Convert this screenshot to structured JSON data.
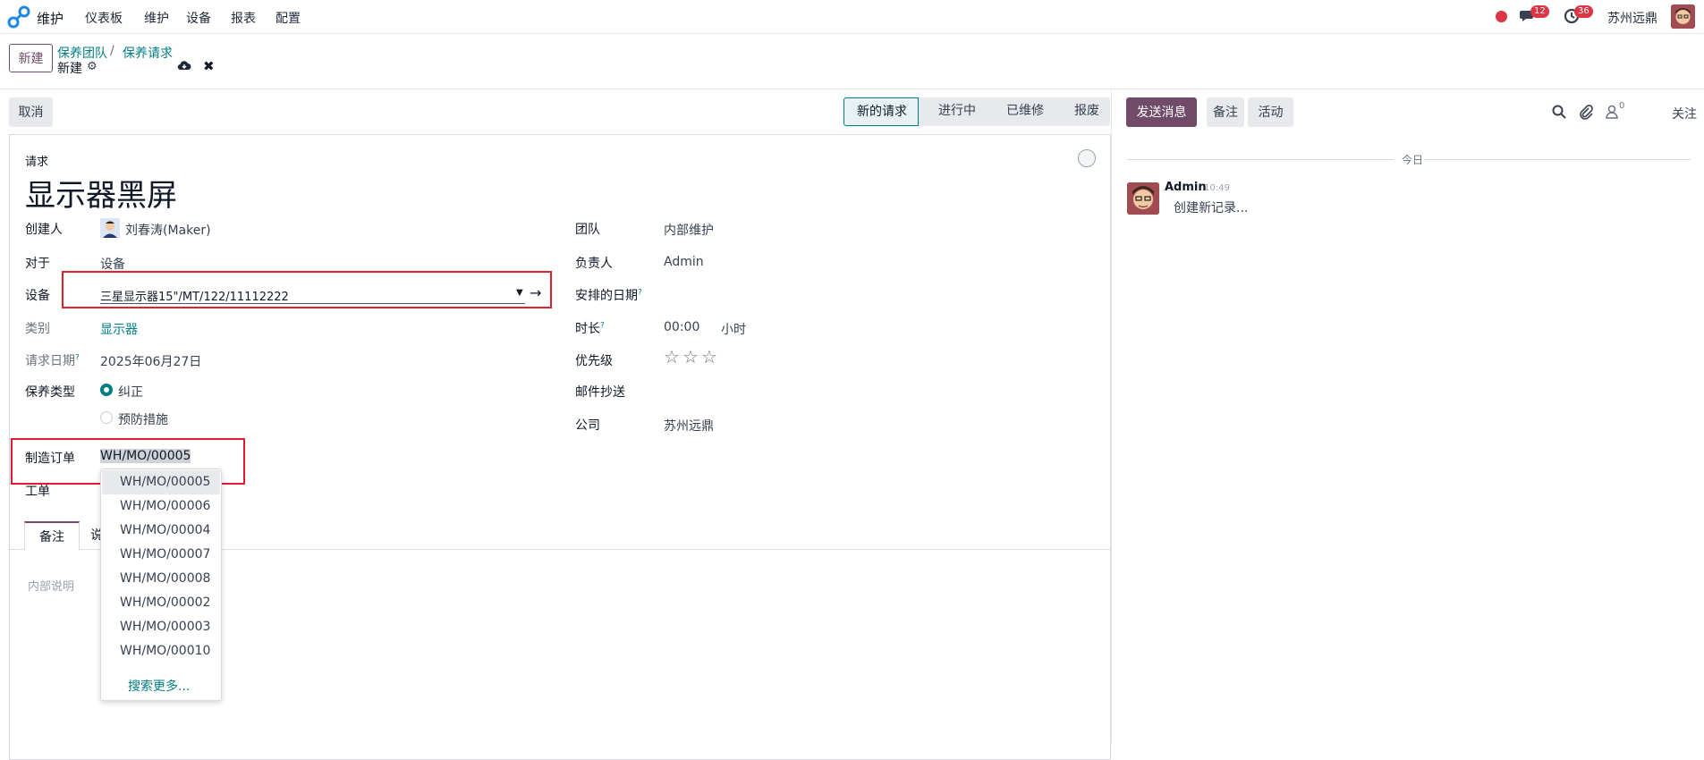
{
  "topbar": {
    "app_name": "维护",
    "menus": [
      "仪表板",
      "维护",
      "设备",
      "报表",
      "配置"
    ],
    "messages_badge": "12",
    "activities_badge": "36",
    "company": "苏州远鼎"
  },
  "control": {
    "new_button": "新建",
    "breadcrumbs": [
      "保养团队",
      "保养请求"
    ],
    "breadcrumb_sep": "/",
    "record_name": "新建"
  },
  "actions": {
    "cancel": "取消",
    "stages": [
      "新的请求",
      "进行中",
      "已维修",
      "报废"
    ],
    "active_stage": "新的请求"
  },
  "form": {
    "request_label": "请求",
    "title": "显示器黑屏",
    "left": {
      "creator_label": "创建人",
      "creator_value": "刘春涛(Maker)",
      "for_label": "对于",
      "for_value": "设备",
      "equipment_label": "设备",
      "equipment_value": "三星显示器15\"/MT/122/11112222",
      "category_label": "类别",
      "category_value": "显示器",
      "request_date_label": "请求日期",
      "request_date_value": "2025年06月27日",
      "maint_type_label": "保养类型",
      "maint_type_options": [
        "纠正",
        "预防措施"
      ],
      "mo_label": "制造订单",
      "mo_value": "WH/MO/00005",
      "workorder_label": "工单"
    },
    "right": {
      "team_label": "团队",
      "team_value": "内部维护",
      "responsible_label": "负责人",
      "responsible_value": "Admin",
      "scheduled_label": "安排的日期",
      "duration_label": "时长",
      "duration_value": "00:00",
      "duration_unit": "小时",
      "priority_label": "优先级",
      "email_cc_label": "邮件抄送",
      "company_label": "公司",
      "company_value": "苏州远鼎"
    },
    "help_mark": "?",
    "tabs": [
      "备注",
      "说"
    ],
    "notes_placeholder": "内部说明"
  },
  "dropdown": {
    "items": [
      "WH/MO/00005",
      "WH/MO/00006",
      "WH/MO/00004",
      "WH/MO/00007",
      "WH/MO/00008",
      "WH/MO/00002",
      "WH/MO/00003",
      "WH/MO/00010"
    ],
    "highlighted": "WH/MO/00005",
    "search_more": "搜索更多..."
  },
  "chatter": {
    "send_message": "发送消息",
    "log_note": "备注",
    "activities": "活动",
    "followers_count": "0",
    "follow": "关注",
    "today": "今日",
    "message": {
      "author": "Admin",
      "time": "10:49",
      "body": "创建新记录..."
    }
  },
  "colors": {
    "brand": "#714b67",
    "link": "#017e84",
    "highlight_box": "#e11d2e",
    "badge": "#dc3545"
  }
}
